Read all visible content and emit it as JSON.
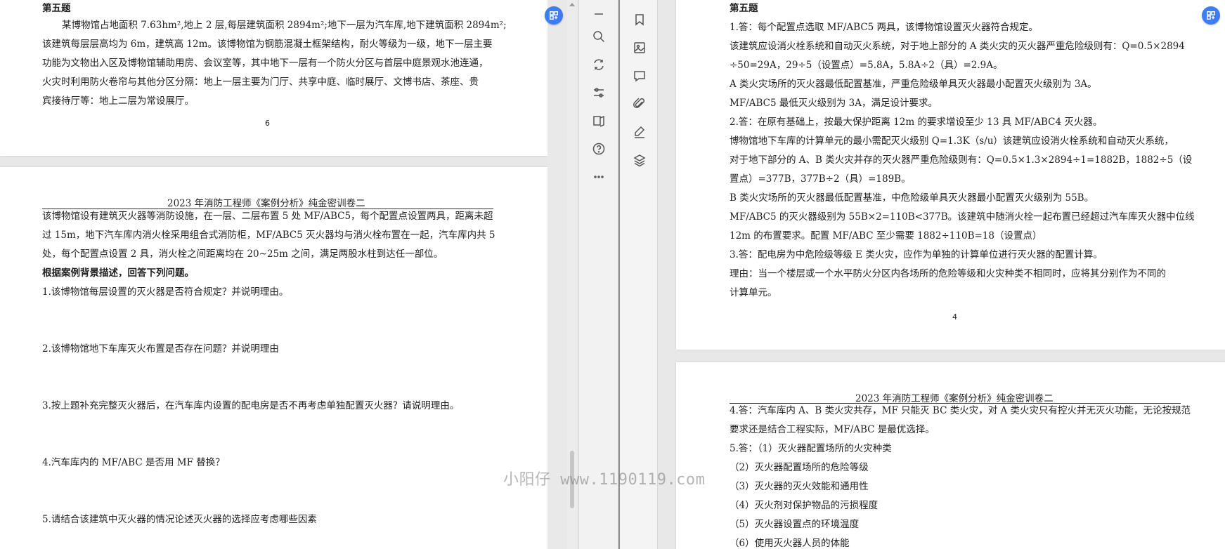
{
  "left_document": {
    "page1": {
      "heading": "第五题",
      "lines": [
        "某博物馆占地面积 7.63hm²,地上 2 层,每层建筑面积 2894m²;地下一层为汽车库,地下建筑面积 2894m²;",
        "该建筑每层层高均为 6m，建筑高 12m。该博物馆为钢筋混凝土框架结构，耐火等级为一级，地下一层主要",
        "功能为文物出入区及博物馆辅助用房、会议室等，其中地下一层有一个防火分区与首层中庭景观水池连通，",
        "火灾时利用防火卷帘与其他分区分隔：地上一层主要为门厅、共享中庭、临时展厅、文博书店、茶座、贵",
        "宾接待厅等：地上二层为常设展厅。"
      ],
      "page_number": "6"
    },
    "page2": {
      "header": "2023 年消防工程师《案例分析》纯金密训卷二",
      "lines": [
        "该博物馆设有建筑灭火器等消防设施，在一层、二层布置 5 处 MF/ABC5，每个配置点设置两具，距离未超",
        "过 15m，地下汽车库内消火栓采用组合式消防柜，MF/ABC5 灭火器均与消火栓布置在一起，汽车库内共 5",
        "处，每个配置点设置 2 具，消火栓之间距离均在 20~25m 之间，满足两股水柱到达任一部位。"
      ],
      "prompt": "根据案例背景描述，回答下列问题。",
      "questions": [
        "1.该博物馆每层设置的灭火器是否符合规定？并说明理由。",
        "2.该博物馆地下车库灭火布置是否存在问题？并说明理由",
        "3.按上题补充完整灭火器后，在汽车库内设置的配电房是否不再考虑单独配置灭火器？请说明理由。",
        "4.汽车库内的 MF/ABC 是否用 MF 替换？",
        "5.请结合该建筑中灭火器的情况论述灭火器的选择应考虑哪些因素"
      ]
    }
  },
  "right_document": {
    "page1": {
      "heading": "第五题",
      "lines": [
        "1.答：每个配置点选取 MF/ABC5 两具，该博物馆设置灭火器符合规定。",
        "该建筑应设消火栓系统和自动灭火系统，对于地上部分的 A 类火灾的灭火器严重危险级则有：Q=0.5×2894",
        "÷50=29A，29÷5（设置点）=5.8A，5.8A÷2（具）=2.9A。",
        "A 类火灾场所的灭火器最低配置基准，严重危险级单具灭火器最小配置灭火级别为 3A。",
        "MF/ABC5 最低灭火级别为 3A，满足设计要求。",
        "2.答：在原有基础上，按最大保护距离 12m 的要求增设至少 13 具 MF/ABC4 灭火器。",
        "博物馆地下车库的计算单元的最小需配灭火级别 Q=1.3K（s/u）该建筑应设消火栓系统和自动灭火系统，",
        "对于地下部分的 A、B 类火灾并存的灭火器严重危险级则有：Q=0.5×1.3×2894÷1=1882B，1882÷5（设",
        "置点）=377B，377B÷2（具）=189B。",
        "B 类火灾场所的灭火器最低配置基准，中危险级单具灭火器最小配置灭火级别为 55B。",
        "MF/ABC5 的灭火器级别为 55B×2=110B<377B。该建筑中随消火栓一起布置已经超过汽车库灭火器中位线",
        "12m 的布置要求。配置 MF/ABC 至少需要 1882÷110B=18（设置点）",
        "3.答：配电房为中危险级等级 E 类火灾，应作为单独的计算单位进行灭火器的配置计算。",
        "理由：当一个楼层或一个水平防火分区内各场所的危险等级和火灾种类不相同时，应将其分别作为不同的",
        "计算单元。"
      ],
      "page_number": "4"
    },
    "page2": {
      "header": "2023 年消防工程师《案例分析》纯金密训卷二",
      "lines": [
        "4.答：汽车库内 A、B 类火灾共存，MF 只能灭 BC 类火灾，对 A 类火灾只有控火并无灭火功能，无论按规范",
        "要求还是结合工程实际，MF/ABC 是最优选择。",
        "5.答：（1）灭火器配置场所的火灾种类",
        "（2）灭火器配置场所的危险等级",
        "（3）灭火器的灭火效能和通用性",
        "（4）灭火剂对保护物品的污损程度",
        "（5）灭火器设置点的环境温度",
        "（6）使用灭火器人员的体能"
      ]
    }
  },
  "toolbar_left": [
    "minus-icon",
    "search-icon",
    "rotate-icon",
    "settings-sliders-icon",
    "reading-mode-icon",
    "help-icon",
    "more-icon"
  ],
  "toolbar_right": [
    "bookmark-icon",
    "image-icon",
    "comment-icon",
    "attachment-icon",
    "sign-icon",
    "layers-icon"
  ],
  "watermark": "小阳仔 www.1190119.com",
  "colors": {
    "accent": "#3c7ef0"
  }
}
